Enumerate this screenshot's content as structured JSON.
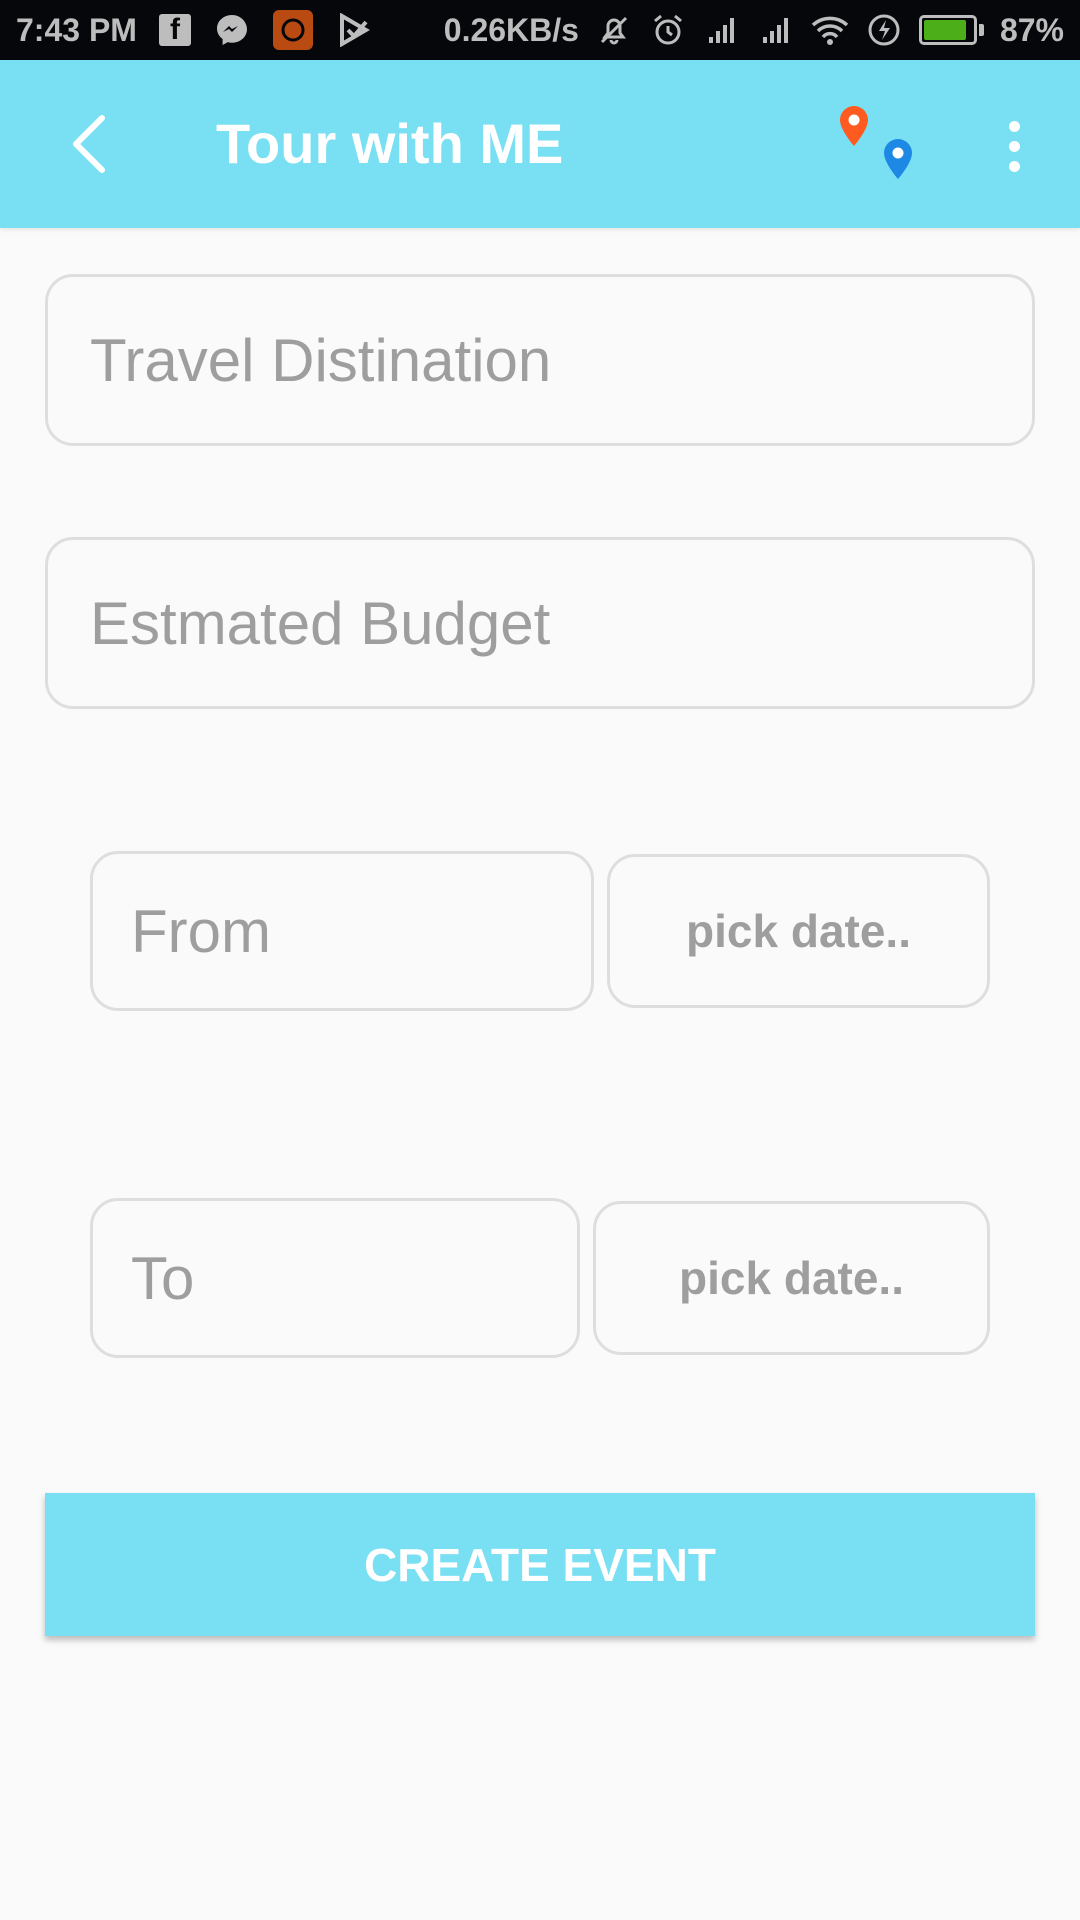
{
  "status_bar": {
    "time": "7:43 PM",
    "network_speed": "0.26KB/s",
    "battery_percent": "87%",
    "battery_level": 0.87,
    "icons": [
      "facebook-icon",
      "messenger-icon",
      "app-icon",
      "play-store-icon",
      "mute-icon",
      "alarm-icon",
      "signal-icon",
      "signal-icon",
      "wifi-icon",
      "charging-icon",
      "battery-icon"
    ]
  },
  "app_bar": {
    "title": "Tour with ME",
    "back_icon": "chevron-left-icon",
    "map_icon": "map-pins-icon",
    "menu_icon": "overflow-menu-icon"
  },
  "form": {
    "destination": {
      "placeholder": "Travel Distination",
      "value": ""
    },
    "budget": {
      "placeholder": "Estmated Budget",
      "value": ""
    },
    "from": {
      "placeholder": "From",
      "value": "",
      "date_label": "pick date.."
    },
    "to": {
      "placeholder": "To",
      "value": "",
      "date_label": "pick date.."
    },
    "submit_label": "CREATE EVENT"
  },
  "colors": {
    "accent": "#79dff2",
    "status_bar": "#06070b",
    "pin_orange": "#ff5a1f",
    "pin_blue": "#1e88e5",
    "placeholder": "#9e9e9e",
    "border": "#dedede"
  }
}
